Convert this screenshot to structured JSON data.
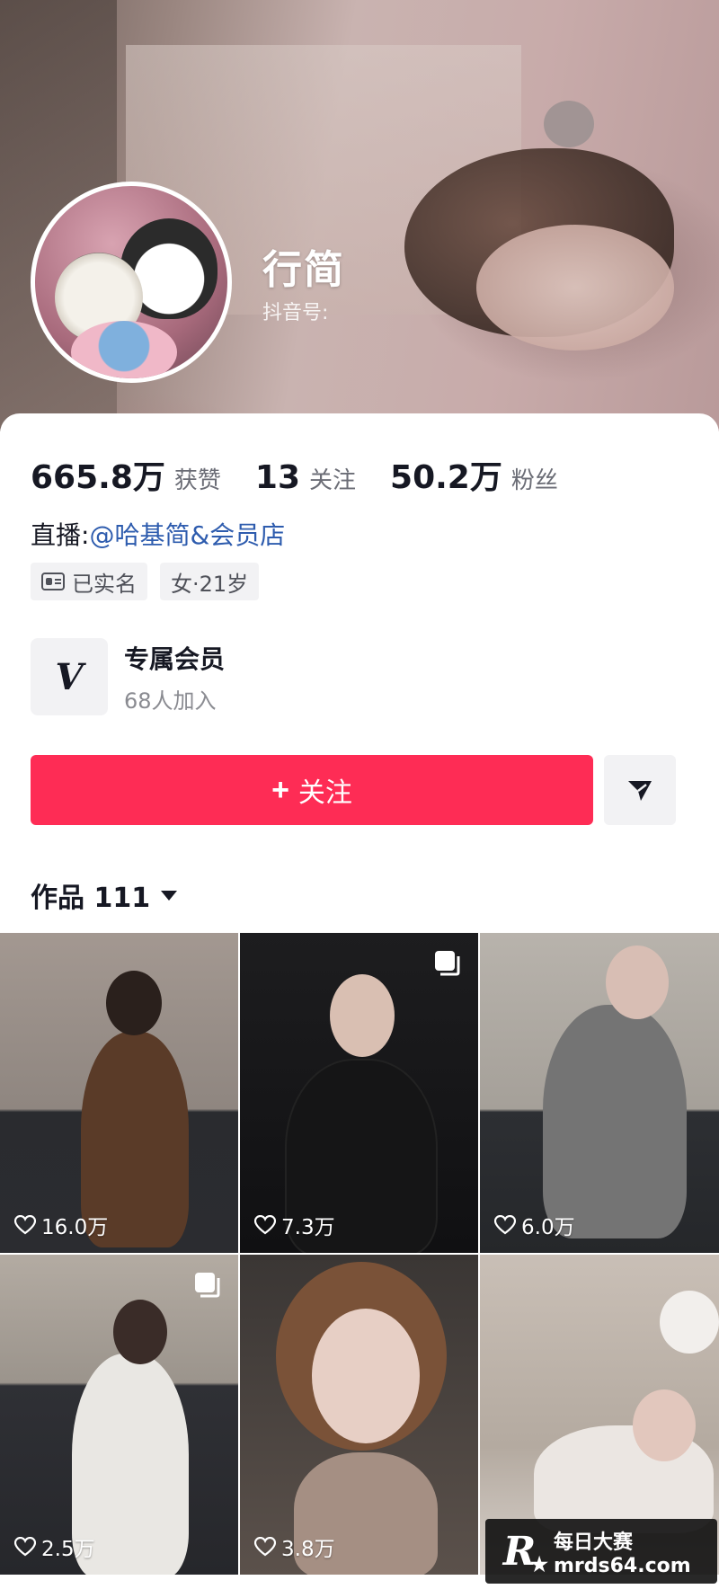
{
  "profile": {
    "nickname": "行简",
    "douyin_id_label": "抖音号:"
  },
  "stats": [
    {
      "value": "665.8万",
      "label": "获赞"
    },
    {
      "value": "13",
      "label": "关注"
    },
    {
      "value": "50.2万",
      "label": "粉丝"
    }
  ],
  "live": {
    "label": "直播:",
    "link": "@哈基简&会员店"
  },
  "tags": {
    "verified": "已实名",
    "gender_age": "女·21岁"
  },
  "member": {
    "logo": "V",
    "title": "专属会员",
    "subtitle": "68人加入"
  },
  "actions": {
    "follow_plus": "+",
    "follow_label": "关注",
    "share_icon": "send-icon"
  },
  "works": {
    "label": "作品 111"
  },
  "grid": [
    {
      "likes": "16.0万",
      "multi": false
    },
    {
      "likes": "7.3万",
      "multi": true
    },
    {
      "likes": "6.0万",
      "multi": false
    },
    {
      "likes": "2.5万",
      "multi": true
    },
    {
      "likes": "3.8万",
      "multi": false
    },
    {
      "likes": "",
      "multi": false
    }
  ],
  "watermark": {
    "logo": "R",
    "title": "每日大赛",
    "url": "mrds64.com"
  },
  "colors": {
    "follow_button": "#fe2c55",
    "link": "#2e5cae",
    "text_primary": "#161823",
    "text_secondary": "#6b6d76",
    "chip_bg": "#f2f2f4"
  }
}
